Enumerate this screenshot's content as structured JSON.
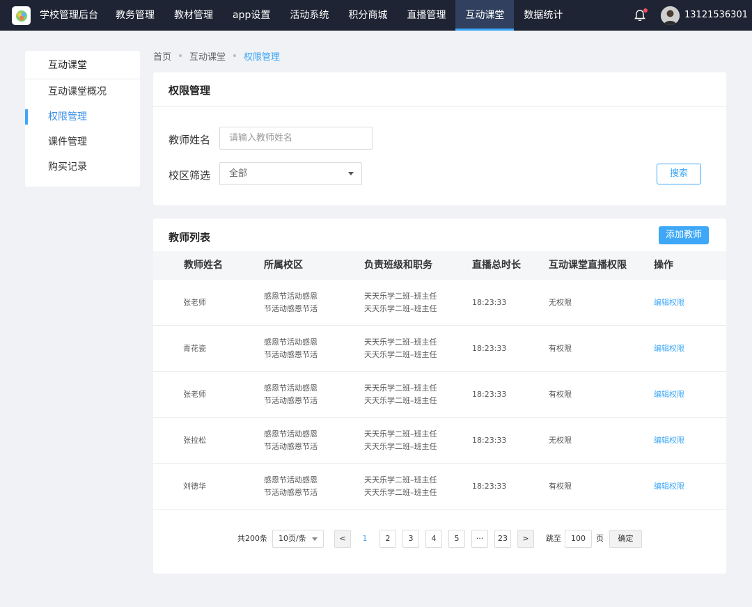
{
  "topbar": {
    "brand": "学校管理后台",
    "nav": [
      "教务管理",
      "教材管理",
      "app设置",
      "活动系统",
      "积分商城",
      "直播管理",
      "互动课堂",
      "数据统计"
    ],
    "active_nav": "互动课堂",
    "user_phone": "13121536301",
    "accent_color": "#3ea7f7"
  },
  "sidebar": {
    "title": "互动课堂",
    "items": [
      "互动课堂概况",
      "权限管理",
      "课件管理",
      "购买记录"
    ],
    "active_item": "权限管理"
  },
  "breadcrumb": [
    "首页",
    "互动课堂",
    "权限管理"
  ],
  "filter": {
    "title": "权限管理",
    "teacher_label": "教师姓名",
    "teacher_placeholder": "请输入教师姓名",
    "campus_label": "校区筛选",
    "campus_value": "全部",
    "search_label": "搜索"
  },
  "list": {
    "title": "教师列表",
    "add_label": "添加教师",
    "columns": [
      "教师姓名",
      "所属校区",
      "负责班级和职务",
      "直播总时长",
      "互动课堂直播权限",
      "操作"
    ],
    "rows": [
      {
        "name": "张老师",
        "campus": [
          "感恩节活动感恩",
          "节活动感恩节活"
        ],
        "classes": [
          "天天乐学二班–班主任",
          "天天乐学二班–班主任"
        ],
        "duration": "18:23:33",
        "permission": "无权限",
        "action": "编辑权限"
      },
      {
        "name": "青花瓷",
        "campus": [
          "感恩节活动感恩",
          "节活动感恩节活"
        ],
        "classes": [
          "天天乐学二班–班主任",
          "天天乐学二班–班主任"
        ],
        "duration": "18:23:33",
        "permission": "有权限",
        "action": "编辑权限"
      },
      {
        "name": "张老师",
        "campus": [
          "感恩节活动感恩",
          "节活动感恩节活"
        ],
        "classes": [
          "天天乐学二班–班主任",
          "天天乐学二班–班主任"
        ],
        "duration": "18:23:33",
        "permission": "有权限",
        "action": "编辑权限"
      },
      {
        "name": "张拉松",
        "campus": [
          "感恩节活动感恩",
          "节活动感恩节活"
        ],
        "classes": [
          "天天乐学二班–班主任",
          "天天乐学二班–班主任"
        ],
        "duration": "18:23:33",
        "permission": "无权限",
        "action": "编辑权限"
      },
      {
        "name": "刘德华",
        "campus": [
          "感恩节活动感恩",
          "节活动感恩节活"
        ],
        "classes": [
          "天天乐学二班–班主任",
          "天天乐学二班–班主任"
        ],
        "duration": "18:23:33",
        "permission": "有权限",
        "action": "编辑权限"
      }
    ]
  },
  "pagination": {
    "total": "共200条",
    "page_size": "10页/条",
    "prev": "<",
    "next": ">",
    "pages": [
      "1",
      "2",
      "3",
      "4",
      "5",
      "···",
      "23"
    ],
    "current": "1",
    "jump_label": "跳至",
    "jump_value": "100",
    "page_unit": "页",
    "confirm": "确定"
  }
}
